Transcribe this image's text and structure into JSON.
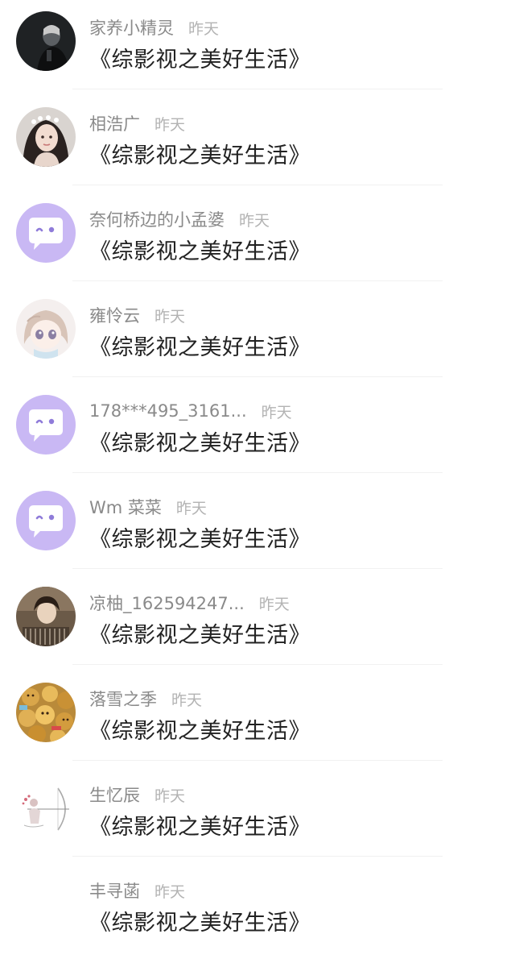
{
  "colors": {
    "username": "#8a8a8a",
    "time": "#b3b3b3",
    "title": "#222222",
    "default_avatar_bg": "#c9b8f4",
    "divider": "#f1f1f1"
  },
  "items": [
    {
      "user": "家养小精灵",
      "time": "昨天",
      "title": "《综影视之美好生活》",
      "avatar": "dark-photo"
    },
    {
      "user": "相浩广",
      "time": "昨天",
      "title": "《综影视之美好生活》",
      "avatar": "girl-photo"
    },
    {
      "user": "奈何桥边的小孟婆",
      "time": "昨天",
      "title": "《综影视之美好生活》",
      "avatar": "default-chat-bubble"
    },
    {
      "user": "雍怜云",
      "time": "昨天",
      "title": "《综影视之美好生活》",
      "avatar": "anime-girl"
    },
    {
      "user": "178***495_3161...",
      "time": "昨天",
      "title": "《综影视之美好生活》",
      "avatar": "default-chat-bubble"
    },
    {
      "user": "Wm 菜菜",
      "time": "昨天",
      "title": "《综影视之美好生活》",
      "avatar": "default-chat-bubble"
    },
    {
      "user": "凉柚_162594247...",
      "time": "昨天",
      "title": "《综影视之美好生活》",
      "avatar": "vintage-photo"
    },
    {
      "user": "落雪之季",
      "time": "昨天",
      "title": "《综影视之美好生活》",
      "avatar": "teddy-bears"
    },
    {
      "user": "生忆辰",
      "time": "昨天",
      "title": "《综影视之美好生活》",
      "avatar": "archer-sketch"
    },
    {
      "user": "丰寻菡",
      "time": "昨天",
      "title": "《综影视之美好生活》",
      "avatar": "none"
    }
  ]
}
